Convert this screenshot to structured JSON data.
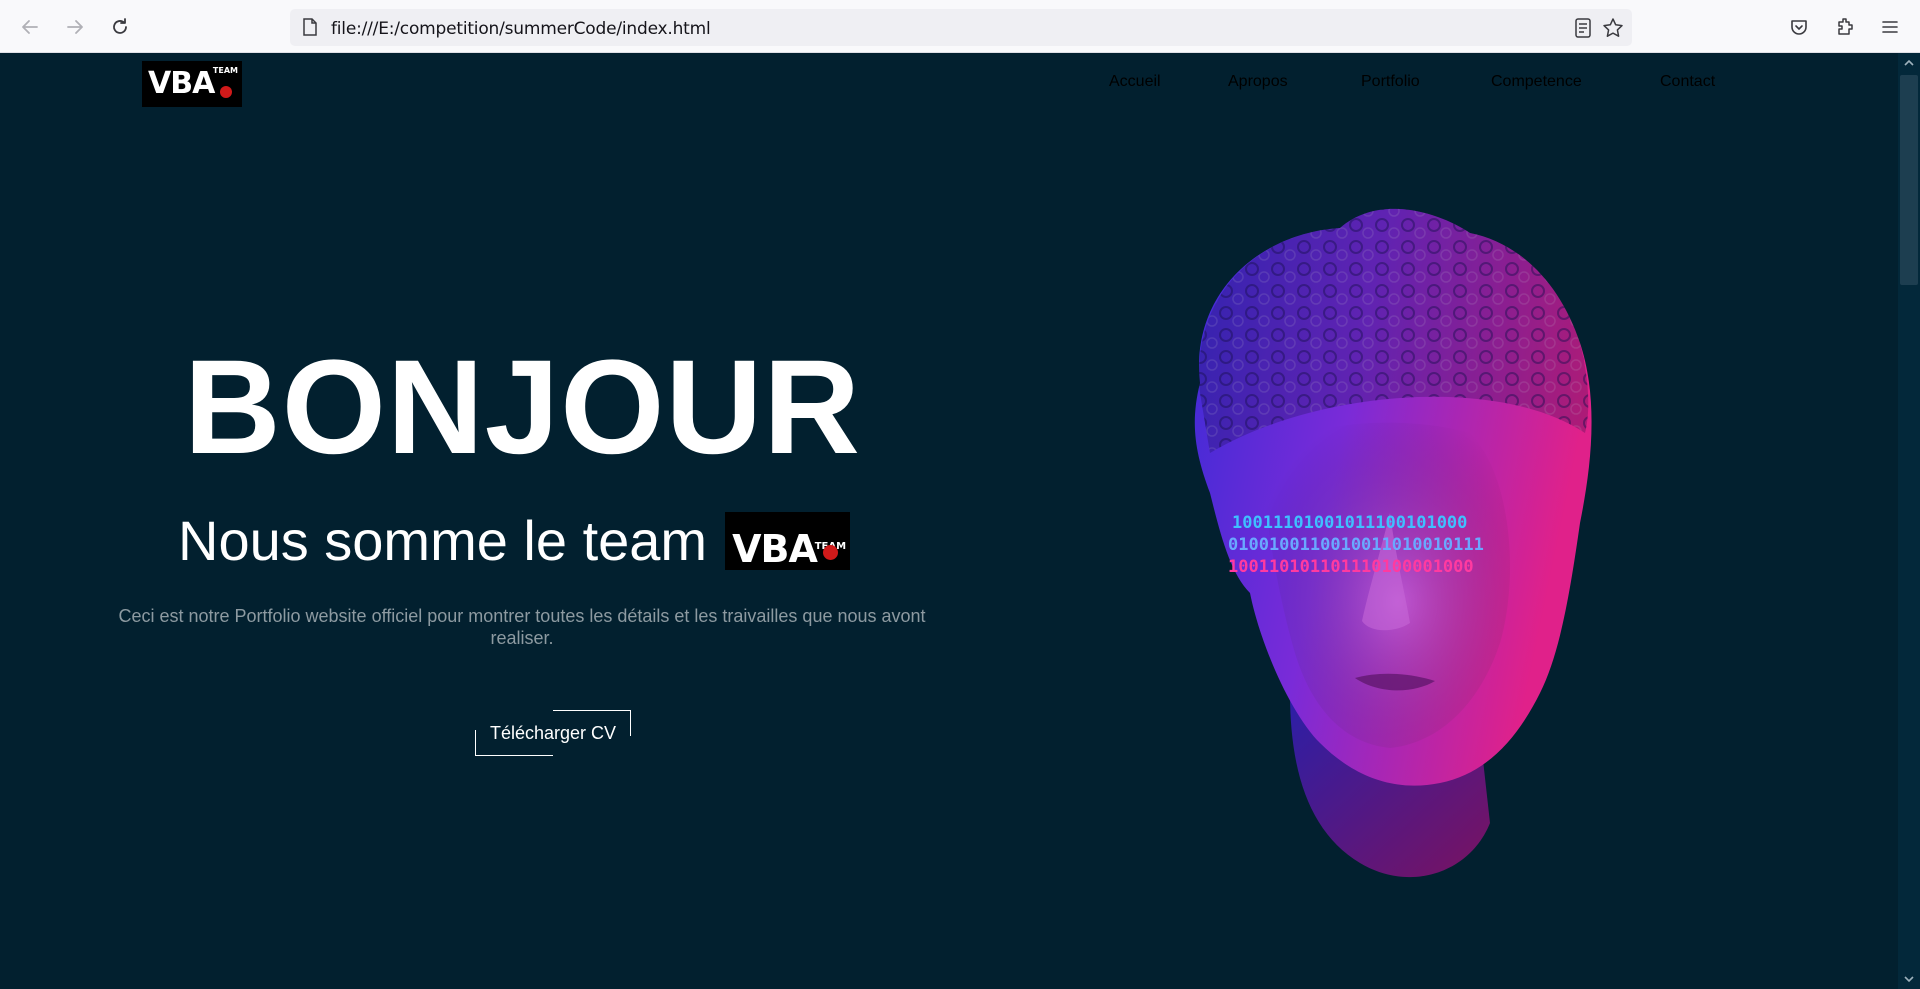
{
  "browser": {
    "url": "file:///E:/competition/summerCode/index.html",
    "icons": [
      "back-arrow-icon",
      "forward-arrow-icon",
      "reload-icon",
      "page-icon",
      "reader-view-icon",
      "bookmark-star-icon",
      "pocket-icon",
      "extensions-icon",
      "menu-icon"
    ]
  },
  "nav": {
    "logo": {
      "letters": "VBA",
      "team": "TEAM"
    },
    "items": [
      {
        "label": "Accueil"
      },
      {
        "label": "Apropos"
      },
      {
        "label": "Portfolio"
      },
      {
        "label": "Competence"
      },
      {
        "label": "Contact"
      }
    ]
  },
  "hero": {
    "title": "BONJOUR",
    "subtitle": "Nous somme le team",
    "subtitle_logo": {
      "letters": "VBA",
      "team": "TEAM"
    },
    "description": "Ceci est notre Portfolio website officiel pour montrer toutes les détails et les traivailles que nous avont realiser.",
    "cta_label": "Télécharger CV",
    "binary_lines": [
      "10011101001011100101000",
      "0100100110010011010010111",
      "100110101101110100001000"
    ]
  },
  "colors": {
    "background": "#02202f",
    "accent_red": "#d11a1a",
    "statue_blue": "#3b2bd6",
    "statue_pink": "#e0218a",
    "description_gray": "#8d9aa1"
  }
}
